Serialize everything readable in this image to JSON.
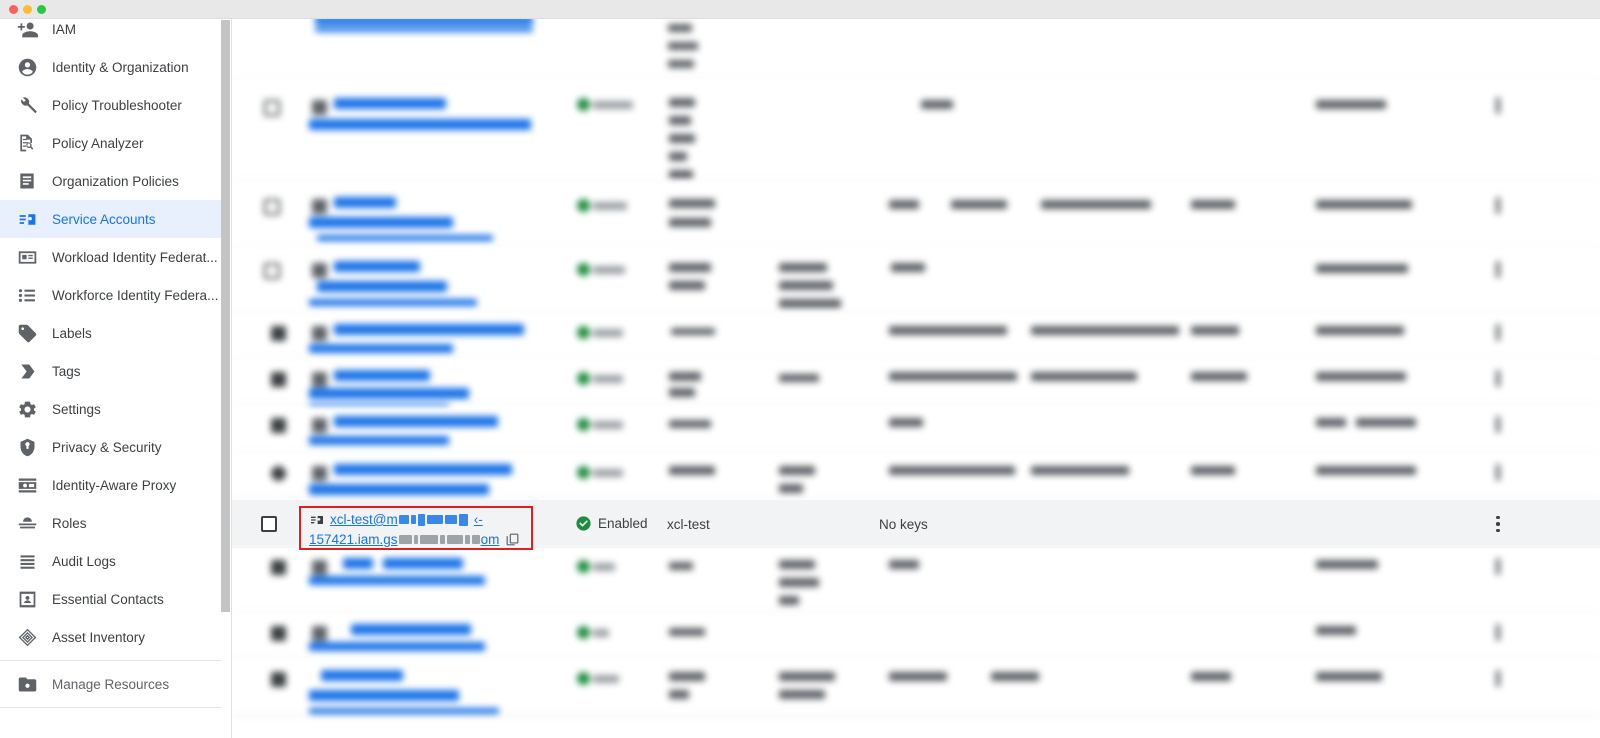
{
  "window": {
    "traffic_lights": [
      "close",
      "minimize",
      "zoom"
    ],
    "chrome_color": "#e8e8e8"
  },
  "sidebar": {
    "scrollbar": {
      "visible": true
    },
    "items": [
      {
        "label": "IAM",
        "icon": "person-add-icon",
        "active": false
      },
      {
        "label": "Identity & Organization",
        "icon": "account-circle-icon",
        "active": false
      },
      {
        "label": "Policy Troubleshooter",
        "icon": "wrench-icon",
        "active": false
      },
      {
        "label": "Policy Analyzer",
        "icon": "document-search-icon",
        "active": false
      },
      {
        "label": "Organization Policies",
        "icon": "list-document-icon",
        "active": false
      },
      {
        "label": "Service Accounts",
        "icon": "vpn-key-badge-icon",
        "active": true
      },
      {
        "label": "Workload Identity Federat...",
        "icon": "badge-card-icon",
        "active": false
      },
      {
        "label": "Workforce Identity Federa...",
        "icon": "bullet-list-icon",
        "active": false
      },
      {
        "label": "Labels",
        "icon": "label-tag-icon",
        "active": false
      },
      {
        "label": "Tags",
        "icon": "tag-arrow-icon",
        "active": false
      },
      {
        "label": "Settings",
        "icon": "gear-icon",
        "active": false
      },
      {
        "label": "Privacy & Security",
        "icon": "shield-icon",
        "active": false
      },
      {
        "label": "Identity-Aware Proxy",
        "icon": "iap-icon",
        "active": false
      },
      {
        "label": "Roles",
        "icon": "roles-hat-icon",
        "active": false
      },
      {
        "label": "Audit Logs",
        "icon": "audit-lines-icon",
        "active": false
      },
      {
        "label": "Essential Contacts",
        "icon": "contact-card-icon",
        "active": false
      },
      {
        "label": "Asset Inventory",
        "icon": "asset-diamond-icon",
        "active": false
      }
    ],
    "footer_items": [
      {
        "label": "Manage Resources",
        "icon": "folder-settings-icon",
        "active": false
      }
    ]
  },
  "table": {
    "selected_row": {
      "checkbox_checked": false,
      "account_icon": "vpn-key-badge-icon",
      "email_prefix": "xcl-test@m",
      "email_suffix_visible": "‹-",
      "email_line2_prefix": "157421.iam.gs",
      "email_line2_suffix": "om",
      "copy_icon": "copy-icon",
      "status": "Enabled",
      "status_icon": "check-circle-icon",
      "status_color": "#1e8e3e",
      "name": "xcl-test",
      "key_id": "No keys",
      "kebab_icon": "more-vert-icon",
      "highlight_color": "#e02020",
      "row_background": "#f1f3f4"
    },
    "redacted_rows_note": "All other service-account rows are blurred / redacted in the screenshot",
    "redacted_row_count": 11
  }
}
